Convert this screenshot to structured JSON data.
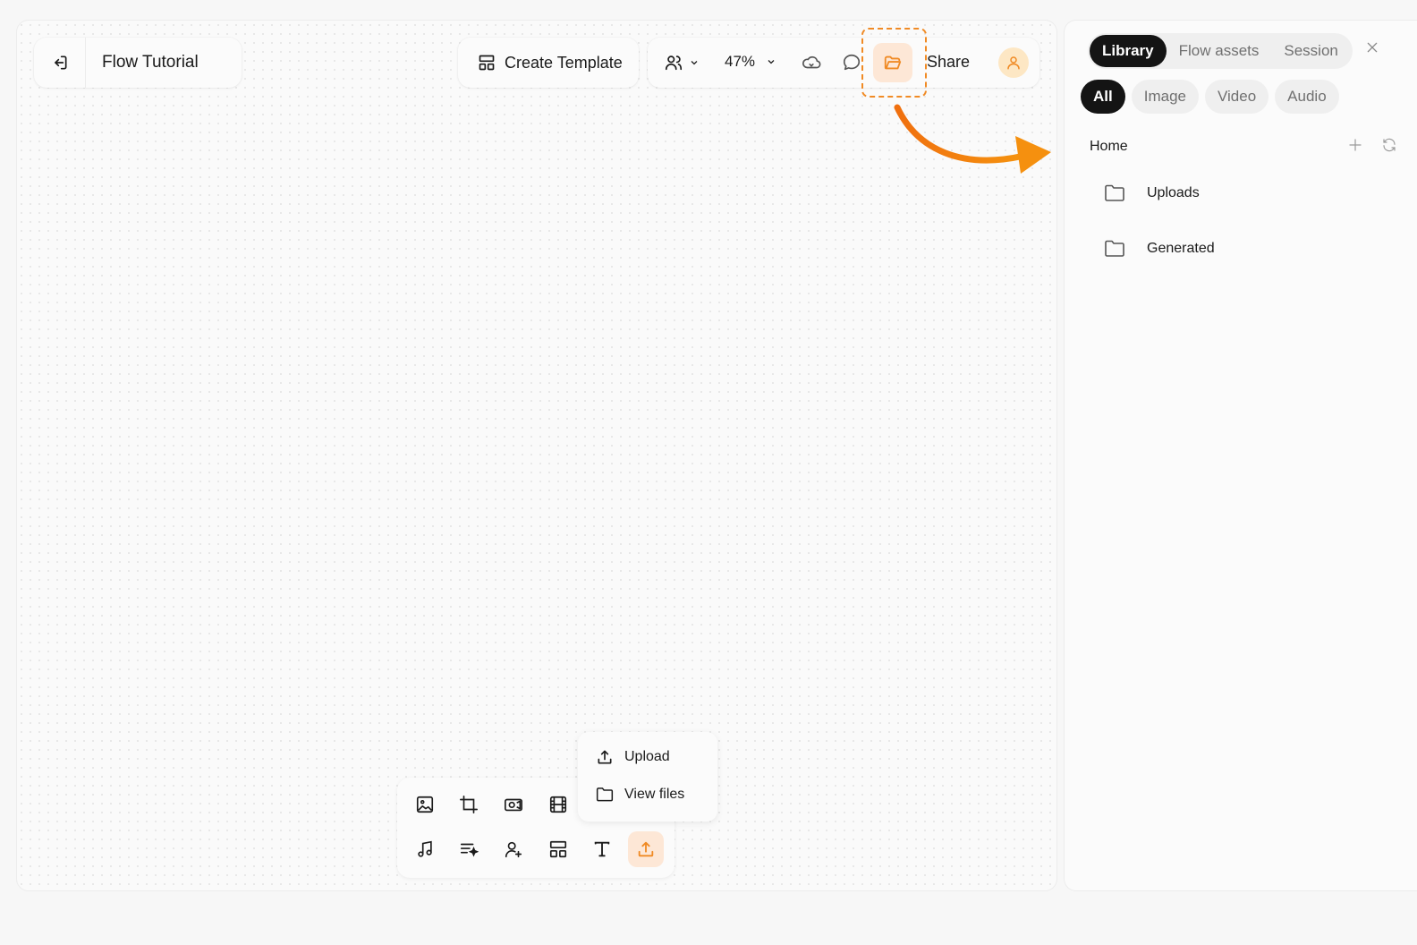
{
  "header": {
    "title": "Flow Tutorial",
    "create_template_label": "Create Template",
    "zoom": "47%",
    "share_label": "Share"
  },
  "panel": {
    "tabs": [
      {
        "label": "Library",
        "active": true
      },
      {
        "label": "Flow assets",
        "active": false
      },
      {
        "label": "Session",
        "active": false
      }
    ],
    "filters": [
      {
        "label": "All",
        "active": true
      },
      {
        "label": "Image",
        "active": false
      },
      {
        "label": "Video",
        "active": false
      },
      {
        "label": "Audio",
        "active": false
      }
    ],
    "breadcrumb": "Home",
    "folders": [
      {
        "label": "Uploads",
        "icon": "folder-icon"
      },
      {
        "label": "Generated",
        "icon": "folder-icon"
      }
    ]
  },
  "popover": {
    "upload_label": "Upload",
    "view_files_label": "View files"
  },
  "toolbar": {
    "row1": [
      "image-icon",
      "crop-icon",
      "video-camera-icon",
      "film-icon"
    ],
    "row2": [
      "music-icon",
      "magic-list-icon",
      "user-plus-icon",
      "layout-icon",
      "text-icon",
      "upload-icon"
    ]
  },
  "colors": {
    "accent": "#f08a24",
    "accent_bg": "#fde7d6",
    "active_tab": "#141414"
  }
}
